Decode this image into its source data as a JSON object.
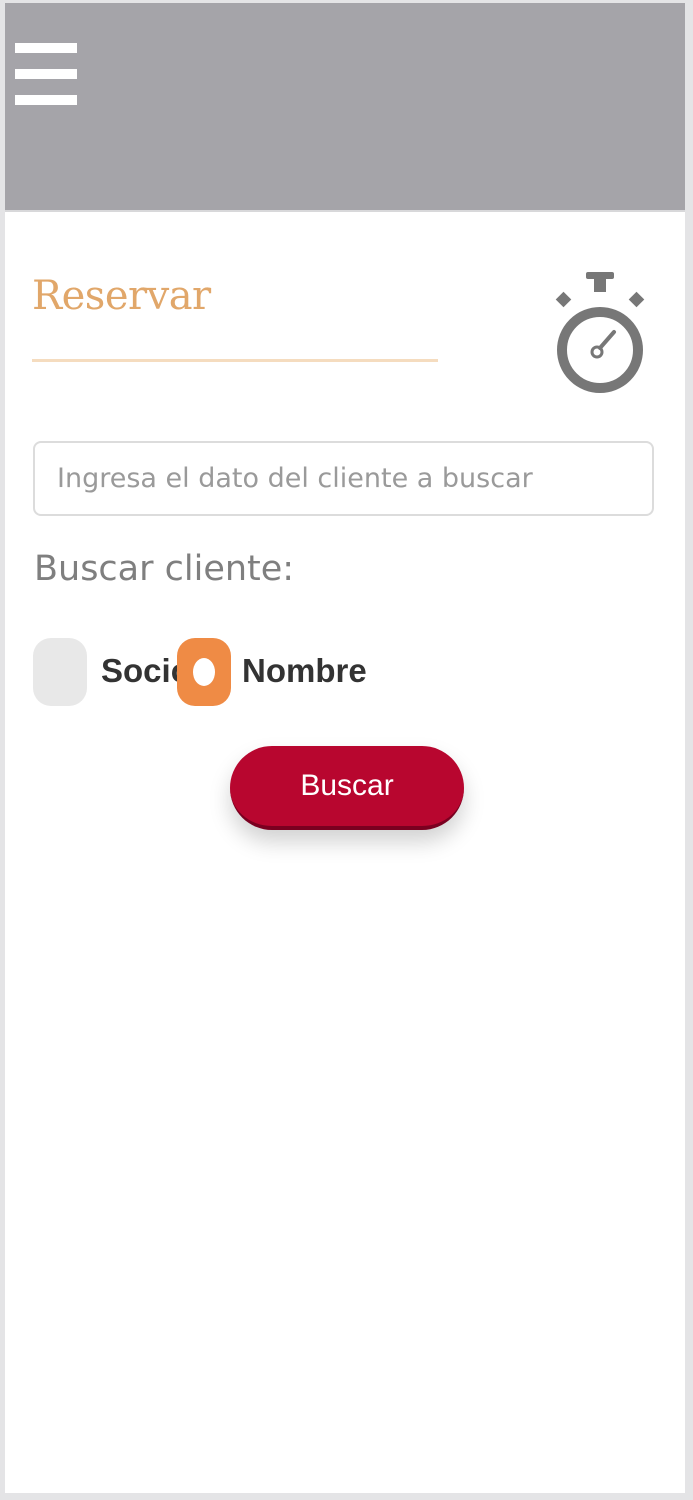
{
  "header": {
    "menu_icon": "hamburger-menu-icon"
  },
  "page": {
    "title": "Reservar",
    "title_icon": "stopwatch-icon"
  },
  "search": {
    "placeholder": "Ingresa el dato del cliente a buscar",
    "value": "",
    "label": "Buscar cliente:"
  },
  "search_type": {
    "options": [
      {
        "label": "Socio",
        "selected": false
      },
      {
        "label": "Nombre",
        "selected": true
      }
    ]
  },
  "actions": {
    "search_button_label": "Buscar"
  },
  "colors": {
    "header_bg": "#a5a4a9",
    "title_accent": "#e1a76a",
    "radio_selected": "#ef8b45",
    "button_bg": "#b8062f"
  }
}
